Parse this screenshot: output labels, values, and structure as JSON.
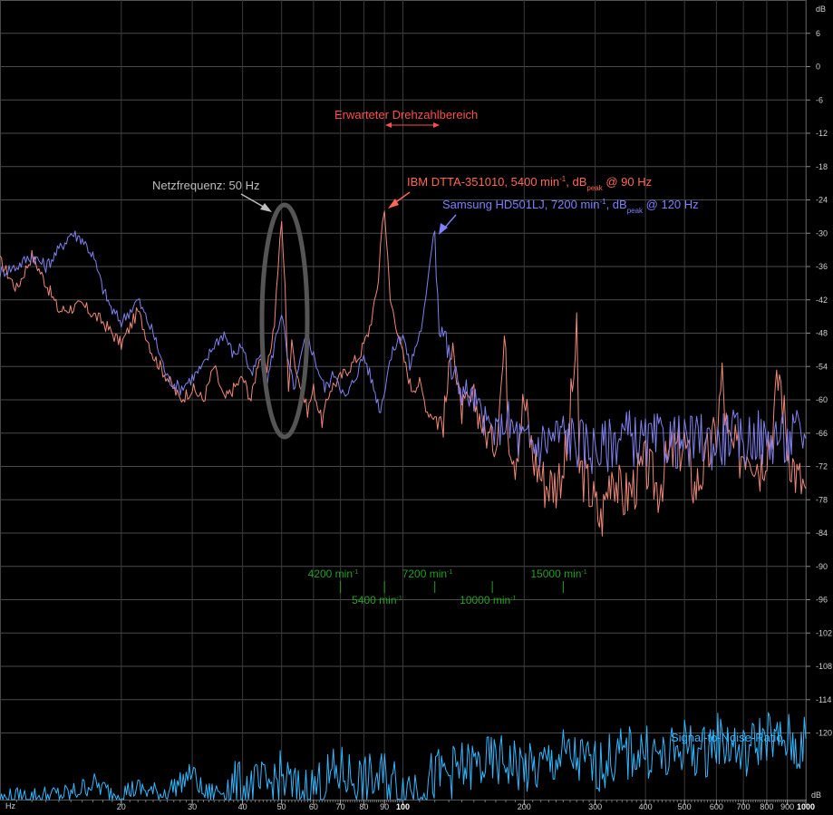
{
  "chart_data": {
    "type": "line",
    "y_unit": "dB",
    "x_unit": "Hz",
    "x_scale": "log",
    "xlim": [
      10,
      1000
    ],
    "ylim": [
      -132,
      12
    ],
    "grid": true,
    "y_ticks": [
      6,
      0,
      -6,
      -12,
      -18,
      -24,
      -30,
      -36,
      -42,
      -48,
      -54,
      -60,
      -66,
      -72,
      -78,
      -84,
      -90,
      -96,
      -102,
      -108,
      -114,
      -120
    ],
    "x_ticks": [
      {
        "value": 20,
        "label": "20"
      },
      {
        "value": 30,
        "label": "30"
      },
      {
        "value": 40,
        "label": "40"
      },
      {
        "value": 50,
        "label": "50"
      },
      {
        "value": 60,
        "label": "60"
      },
      {
        "value": 70,
        "label": "70"
      },
      {
        "value": 80,
        "label": "80"
      },
      {
        "value": 90,
        "label": "90"
      },
      {
        "value": 100,
        "label": "100",
        "bold": true
      },
      {
        "value": 200,
        "label": "200"
      },
      {
        "value": 300,
        "label": "300"
      },
      {
        "value": 400,
        "label": "400"
      },
      {
        "value": 500,
        "label": "500"
      },
      {
        "value": 600,
        "label": "600"
      },
      {
        "value": 700,
        "label": "700"
      },
      {
        "value": 800,
        "label": "800"
      },
      {
        "value": 900,
        "label": "900"
      },
      {
        "value": 1000,
        "label": "1000",
        "bold": true
      }
    ],
    "series": [
      {
        "name": "IBM DTTA-351010, 5400 min⁻¹",
        "color": "#f08878",
        "points": [
          [
            10,
            -35
          ],
          [
            11,
            -40
          ],
          [
            12,
            -34
          ],
          [
            13,
            -39
          ],
          [
            14,
            -44
          ],
          [
            16,
            -43
          ],
          [
            18,
            -46
          ],
          [
            20,
            -50
          ],
          [
            22,
            -44
          ],
          [
            24,
            -52
          ],
          [
            26,
            -56
          ],
          [
            28,
            -60
          ],
          [
            30,
            -58
          ],
          [
            32,
            -60
          ],
          [
            34,
            -54
          ],
          [
            36,
            -60
          ],
          [
            38,
            -58
          ],
          [
            40,
            -56
          ],
          [
            42,
            -60
          ],
          [
            44,
            -52
          ],
          [
            46,
            -55
          ],
          [
            48,
            -46
          ],
          [
            49,
            -36
          ],
          [
            50,
            -28
          ],
          [
            51,
            -40
          ],
          [
            52,
            -58
          ],
          [
            53,
            -50
          ],
          [
            55,
            -56
          ],
          [
            58,
            -62
          ],
          [
            60,
            -58
          ],
          [
            63,
            -64
          ],
          [
            66,
            -58
          ],
          [
            70,
            -56
          ],
          [
            74,
            -54
          ],
          [
            78,
            -52
          ],
          [
            82,
            -48
          ],
          [
            85,
            -43
          ],
          [
            87,
            -38
          ],
          [
            88,
            -32
          ],
          [
            89,
            -28
          ],
          [
            90,
            -25
          ],
          [
            91,
            -31
          ],
          [
            93,
            -42
          ],
          [
            96,
            -46
          ],
          [
            100,
            -52
          ],
          [
            105,
            -58
          ],
          [
            110,
            -57
          ],
          [
            115,
            -62
          ],
          [
            120,
            -63
          ],
          [
            126,
            -64
          ],
          [
            130,
            -56
          ],
          [
            133,
            -47
          ],
          [
            136,
            -58
          ],
          [
            140,
            -62
          ],
          [
            150,
            -60
          ],
          [
            160,
            -66
          ],
          [
            170,
            -68
          ],
          [
            180,
            -48
          ],
          [
            182,
            -64
          ],
          [
            190,
            -70
          ],
          [
            200,
            -60
          ],
          [
            210,
            -70
          ],
          [
            225,
            -75
          ],
          [
            240,
            -75
          ],
          [
            255,
            -70
          ],
          [
            270,
            -49
          ],
          [
            274,
            -72
          ],
          [
            290,
            -76
          ],
          [
            310,
            -82
          ],
          [
            330,
            -72
          ],
          [
            350,
            -78
          ],
          [
            370,
            -76
          ],
          [
            400,
            -72
          ],
          [
            430,
            -76
          ],
          [
            460,
            -70
          ],
          [
            500,
            -68
          ],
          [
            530,
            -76
          ],
          [
            560,
            -72
          ],
          [
            600,
            -66
          ],
          [
            620,
            -56
          ],
          [
            640,
            -68
          ],
          [
            680,
            -70
          ],
          [
            720,
            -68
          ],
          [
            770,
            -72
          ],
          [
            820,
            -66
          ],
          [
            860,
            -55
          ],
          [
            900,
            -68
          ],
          [
            950,
            -74
          ],
          [
            1000,
            -76
          ]
        ]
      },
      {
        "name": "Samsung HD501LJ, 7200 min⁻¹",
        "color": "#8080ee",
        "points": [
          [
            10,
            -37
          ],
          [
            11,
            -36
          ],
          [
            12,
            -34
          ],
          [
            13,
            -36
          ],
          [
            14,
            -33
          ],
          [
            15,
            -30
          ],
          [
            16,
            -31
          ],
          [
            17,
            -34
          ],
          [
            18,
            -40
          ],
          [
            19,
            -44
          ],
          [
            20,
            -46
          ],
          [
            22,
            -42
          ],
          [
            24,
            -48
          ],
          [
            26,
            -56
          ],
          [
            28,
            -58
          ],
          [
            30,
            -56
          ],
          [
            32,
            -54
          ],
          [
            34,
            -50
          ],
          [
            36,
            -48
          ],
          [
            38,
            -52
          ],
          [
            40,
            -50
          ],
          [
            42,
            -56
          ],
          [
            44,
            -52
          ],
          [
            46,
            -57
          ],
          [
            48,
            -50
          ],
          [
            50,
            -44
          ],
          [
            52,
            -54
          ],
          [
            54,
            -58
          ],
          [
            56,
            -52
          ],
          [
            58,
            -48
          ],
          [
            60,
            -52
          ],
          [
            64,
            -58
          ],
          [
            68,
            -55
          ],
          [
            72,
            -60
          ],
          [
            76,
            -56
          ],
          [
            80,
            -52
          ],
          [
            84,
            -57
          ],
          [
            88,
            -62
          ],
          [
            92,
            -54
          ],
          [
            96,
            -50
          ],
          [
            100,
            -48
          ],
          [
            104,
            -54
          ],
          [
            108,
            -50
          ],
          [
            112,
            -46
          ],
          [
            115,
            -40
          ],
          [
            117,
            -34
          ],
          [
            119,
            -30
          ],
          [
            120,
            -29
          ],
          [
            121,
            -36
          ],
          [
            123,
            -46
          ],
          [
            127,
            -48
          ],
          [
            132,
            -55
          ],
          [
            140,
            -58
          ],
          [
            150,
            -60
          ],
          [
            160,
            -64
          ],
          [
            170,
            -66
          ],
          [
            180,
            -64
          ],
          [
            190,
            -66
          ],
          [
            200,
            -68
          ],
          [
            215,
            -68
          ],
          [
            230,
            -67
          ],
          [
            250,
            -66
          ],
          [
            280,
            -68
          ],
          [
            310,
            -69
          ],
          [
            350,
            -66
          ],
          [
            400,
            -68
          ],
          [
            450,
            -67
          ],
          [
            500,
            -68
          ],
          [
            550,
            -67
          ],
          [
            600,
            -68
          ],
          [
            650,
            -66
          ],
          [
            700,
            -68
          ],
          [
            750,
            -66
          ],
          [
            800,
            -68
          ],
          [
            850,
            -66
          ],
          [
            900,
            -68
          ],
          [
            950,
            -66
          ],
          [
            1000,
            -67
          ]
        ]
      },
      {
        "name": "Signal-to-Noise-Ratio",
        "color": "#30b8ff",
        "points": [
          [
            10,
            -132
          ],
          [
            15,
            -131
          ],
          [
            17,
            -129
          ],
          [
            19,
            -131
          ],
          [
            22,
            -130
          ],
          [
            25,
            -131
          ],
          [
            28,
            -129
          ],
          [
            30,
            -127
          ],
          [
            32,
            -131
          ],
          [
            38,
            -130
          ],
          [
            45,
            -130
          ],
          [
            50,
            -128
          ],
          [
            55,
            -131
          ],
          [
            60,
            -130
          ],
          [
            70,
            -127
          ],
          [
            80,
            -129
          ],
          [
            90,
            -128
          ],
          [
            100,
            -130
          ],
          [
            110,
            -129
          ],
          [
            130,
            -127
          ],
          [
            150,
            -126
          ],
          [
            180,
            -125
          ],
          [
            210,
            -127
          ],
          [
            250,
            -124
          ],
          [
            300,
            -126
          ],
          [
            350,
            -124
          ],
          [
            400,
            -123
          ],
          [
            450,
            -125
          ],
          [
            500,
            -122
          ],
          [
            550,
            -124
          ],
          [
            600,
            -121
          ],
          [
            650,
            -122
          ],
          [
            700,
            -124
          ],
          [
            750,
            -122
          ],
          [
            800,
            -120
          ],
          [
            850,
            -122
          ],
          [
            900,
            -121
          ],
          [
            950,
            -123
          ],
          [
            1000,
            -121
          ]
        ]
      }
    ],
    "annotations": [
      {
        "id": "netz",
        "text": "Netzfrequenz: 50 Hz",
        "color": "#bdbdbd"
      },
      {
        "id": "ibm",
        "text": "IBM DTTA-351010, 5400 min",
        "sup": "-1",
        "mid": ", dB",
        "sub": "peak",
        "tail": " @ 90 Hz",
        "color": "#ff6655"
      },
      {
        "id": "sam",
        "text": "Samsung HD501LJ, 7200 min",
        "sup": "-1",
        "mid": ", dB",
        "sub": "peak",
        "tail": " @ 120 Hz",
        "color": "#7f7fff"
      },
      {
        "id": "erw",
        "text": "Erwarteter Drehzahlbereich",
        "color": "#ff4d4d"
      },
      {
        "id": "snr",
        "text": "Signal-to-Noise-Ratio",
        "color": "#30b8ff"
      }
    ],
    "rpm_markers": [
      {
        "rpm": "4200 min",
        "hz": 70,
        "row": 1
      },
      {
        "rpm": "5400 min",
        "hz": 90,
        "row": 2
      },
      {
        "rpm": "7200 min",
        "hz": 120,
        "row": 1
      },
      {
        "rpm": "10000 min",
        "hz": 166.7,
        "row": 2
      },
      {
        "rpm": "15000 min",
        "hz": 250,
        "row": 1
      }
    ],
    "rpm_sup": "-1"
  }
}
